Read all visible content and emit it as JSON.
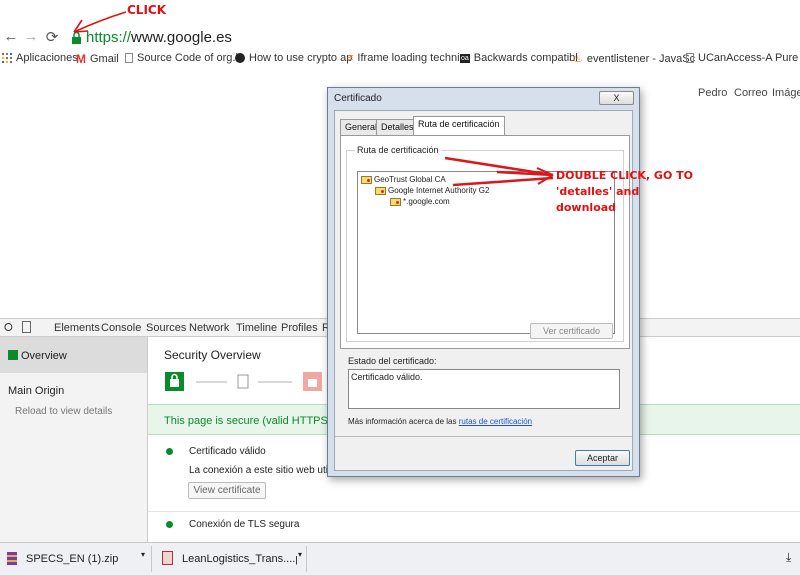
{
  "annotations": {
    "click": "CLICK",
    "double_click": "DOUBLE CLICK, GO TO 'detalles' and download",
    "double_click_lines": [
      "DOUBLE CLICK, GO TO",
      "'detalles' and",
      "download"
    ],
    "color": "#e01010"
  },
  "browser": {
    "url_scheme": "https://",
    "url_host": "www.google.es",
    "secure_color": "#0a8a2a",
    "back_icon": "back-arrow-icon",
    "forward_icon": "forward-arrow-icon",
    "reload_icon": "reload-icon",
    "lock_icon": "lock-icon"
  },
  "bookmarks": [
    {
      "label": "Aplicaciones",
      "icon": "apps-grid-icon"
    },
    {
      "label": "Gmail",
      "icon": "gmail-icon"
    },
    {
      "label": "Source Code of org.b",
      "icon": "page-icon"
    },
    {
      "label": "How to use crypto ap",
      "icon": "github-icon"
    },
    {
      "label": "Iframe loading techni",
      "icon": "stack-icon"
    },
    {
      "label": "Backwards compatibl",
      "icon": "oa-icon"
    },
    {
      "label": "eventlistener - JavaSc",
      "icon": "flame-icon"
    },
    {
      "label": "UCanAccess-A Pure Ja",
      "icon": "page-icon"
    }
  ],
  "google_links": [
    "Pedro",
    "Correo",
    "Imáge"
  ],
  "devtools": {
    "tabs": [
      "Elements",
      "Console",
      "Sources",
      "Network",
      "Timeline",
      "Profiles",
      "R"
    ],
    "sidebar": {
      "overview": "Overview",
      "main_origin": "Main Origin",
      "reload_hint": "Reload to view details"
    },
    "main": {
      "title": "Security Overview",
      "secure_banner": "This page is secure (valid HTTPS).",
      "items": [
        {
          "title": "Certificado válido",
          "desc": "La conexión a este sitio web utiliza",
          "button": "View certificate"
        },
        {
          "title": "Conexión de TLS segura",
          "desc": ""
        }
      ]
    }
  },
  "downloads": [
    {
      "name": "SPECS_EN (1).zip",
      "icon": "archive-icon"
    },
    {
      "name": "LeanLogistics_Trans....pp...",
      "icon": "doc-icon"
    }
  ],
  "dialog": {
    "title": "Certificado",
    "close": "X",
    "tabs": [
      "General",
      "Detalles",
      "Ruta de certificación"
    ],
    "group_label": "Ruta de certificación",
    "tree": [
      {
        "label": "GeoTrust Global CA",
        "level": 0
      },
      {
        "label": "Google Internet Authority G2",
        "level": 1
      },
      {
        "label": "*.google.com",
        "level": 2
      }
    ],
    "view_cert_button": "Ver certificado",
    "status_label": "Estado del certificado:",
    "status_text": "Certificado válido.",
    "more_info_prefix": "Más información acerca de las",
    "more_info_link": "rutas de certificación",
    "accept_button": "Aceptar"
  }
}
